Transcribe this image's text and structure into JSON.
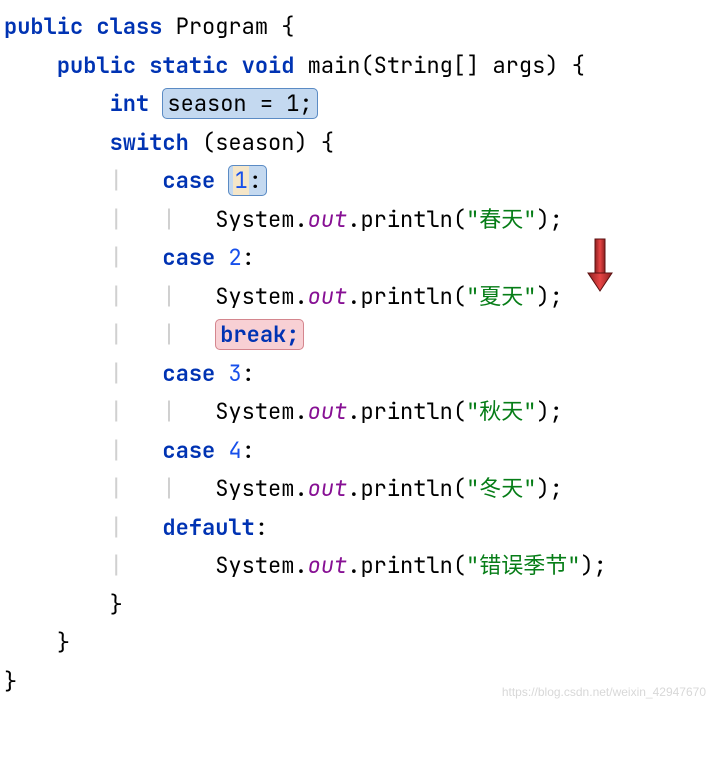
{
  "line1": {
    "kw1": "public",
    "kw2": "class",
    "name": "Program",
    "brace": "{"
  },
  "line2": {
    "kw1": "public",
    "kw2": "static",
    "kw3": "void",
    "mth": "main",
    "lp": "(",
    "typ": "String",
    "arr": "[]",
    "arg": "args",
    "rp": ")",
    "brace": "{"
  },
  "line3": {
    "kw": "int",
    "hl": "season = 1;"
  },
  "line4": {
    "kw": "switch",
    "lp": "(",
    "var": "season",
    "rp": ")",
    "brace": "{"
  },
  "case1": {
    "kw": "case",
    "cursor": "1",
    "hl": ":"
  },
  "print1": {
    "cls": "System",
    "dot1": ".",
    "fld": "out",
    "dot2": ".",
    "mth": "println",
    "lp": "(",
    "str": "\"春天\"",
    "rp": ")",
    "semi": ";"
  },
  "case2": {
    "kw": "case",
    "num": "2",
    "colon": ":"
  },
  "print2": {
    "cls": "System",
    "dot1": ".",
    "fld": "out",
    "dot2": ".",
    "mth": "println",
    "lp": "(",
    "str": "\"夏天\"",
    "rp": ")",
    "semi": ";"
  },
  "break": {
    "hl": "break;"
  },
  "case3": {
    "kw": "case",
    "num": "3",
    "colon": ":"
  },
  "print3": {
    "cls": "System",
    "dot1": ".",
    "fld": "out",
    "dot2": ".",
    "mth": "println",
    "lp": "(",
    "str": "\"秋天\"",
    "rp": ")",
    "semi": ";"
  },
  "case4": {
    "kw": "case",
    "num": "4",
    "colon": ":"
  },
  "print4": {
    "cls": "System",
    "dot1": ".",
    "fld": "out",
    "dot2": ".",
    "mth": "println",
    "lp": "(",
    "str": "\"冬天\"",
    "rp": ")",
    "semi": ";"
  },
  "default": {
    "kw": "default",
    "colon": ":"
  },
  "print5": {
    "cls": "System",
    "dot1": ".",
    "fld": "out",
    "dot2": ".",
    "mth": "println",
    "lp": "(",
    "str": "\"错误季节\"",
    "rp": ")",
    "semi": ";"
  },
  "close1": "}",
  "close2": "}",
  "close3": "}",
  "watermark": "https://blog.csdn.net/weixin_42947670"
}
